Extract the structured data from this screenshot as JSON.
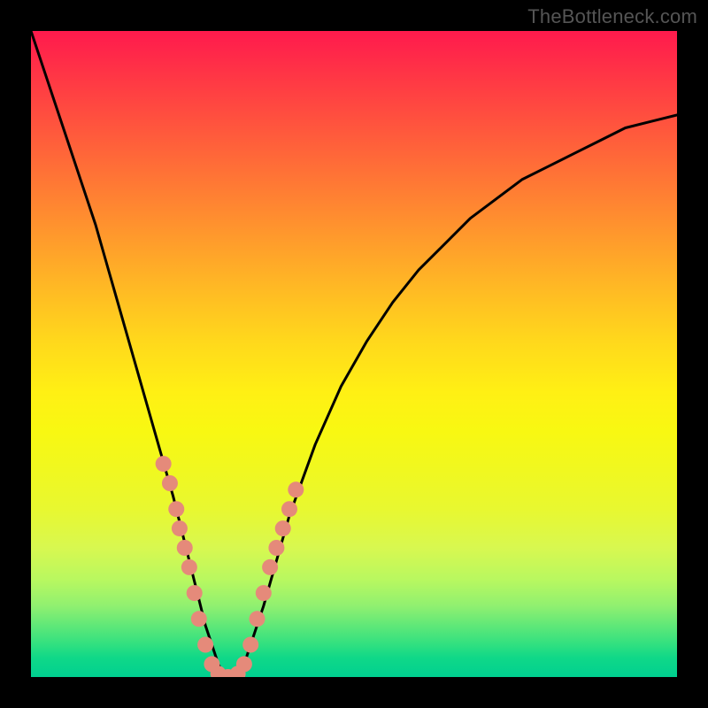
{
  "watermark": "TheBottleneck.com",
  "chart_data": {
    "type": "line",
    "title": "",
    "xlabel": "",
    "ylabel": "",
    "xlim": [
      0,
      100
    ],
    "ylim": [
      0,
      100
    ],
    "grid": false,
    "legend": false,
    "series": [
      {
        "name": "curve",
        "color": "#000000",
        "x": [
          0,
          2,
          4,
          6,
          8,
          10,
          12,
          14,
          16,
          18,
          20,
          22,
          24,
          26,
          27,
          28,
          29,
          30,
          31,
          32,
          33,
          34,
          36,
          38,
          40,
          44,
          48,
          52,
          56,
          60,
          64,
          68,
          72,
          76,
          80,
          84,
          88,
          92,
          96,
          100
        ],
        "y": [
          100,
          94,
          88,
          82,
          76,
          70,
          63,
          56,
          49,
          42,
          35,
          28,
          20,
          12,
          8,
          5,
          2,
          0,
          0,
          0,
          2,
          5,
          11,
          18,
          25,
          36,
          45,
          52,
          58,
          63,
          67,
          71,
          74,
          77,
          79,
          81,
          83,
          85,
          86,
          87
        ]
      }
    ],
    "markers": [
      {
        "name": "dots",
        "color": "#e58a7a",
        "points": [
          {
            "x": 20.5,
            "y": 33
          },
          {
            "x": 21.5,
            "y": 30
          },
          {
            "x": 22.5,
            "y": 26
          },
          {
            "x": 23.0,
            "y": 23
          },
          {
            "x": 23.8,
            "y": 20
          },
          {
            "x": 24.5,
            "y": 17
          },
          {
            "x": 25.3,
            "y": 13
          },
          {
            "x": 26.0,
            "y": 9
          },
          {
            "x": 27.0,
            "y": 5
          },
          {
            "x": 28.0,
            "y": 2
          },
          {
            "x": 29.0,
            "y": 0.5
          },
          {
            "x": 30.5,
            "y": 0
          },
          {
            "x": 32.0,
            "y": 0.5
          },
          {
            "x": 33.0,
            "y": 2
          },
          {
            "x": 34.0,
            "y": 5
          },
          {
            "x": 35.0,
            "y": 9
          },
          {
            "x": 36.0,
            "y": 13
          },
          {
            "x": 37.0,
            "y": 17
          },
          {
            "x": 38.0,
            "y": 20
          },
          {
            "x": 39.0,
            "y": 23
          },
          {
            "x": 40.0,
            "y": 26
          },
          {
            "x": 41.0,
            "y": 29
          }
        ]
      }
    ]
  }
}
